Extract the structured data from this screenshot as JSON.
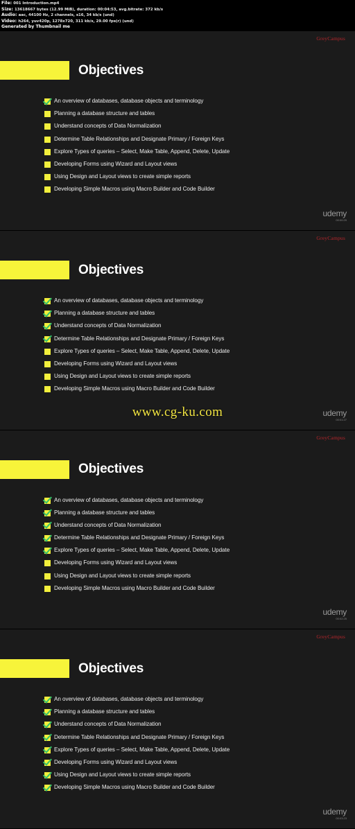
{
  "mediainfo": {
    "lines": [
      {
        "key": "File:",
        "value": "001 Introduction.mp4"
      },
      {
        "key": "Size:",
        "value": "13618667 bytes (12.99 MiB), duration: 00:04:53, avg.bitrate: 372 kb/s"
      },
      {
        "key": "Audio:",
        "value": "aac, 44100 Hz, 2 channels, s16, 34 kb/s (und)"
      },
      {
        "key": "Video:",
        "value": "h264, yuv420p, 1278x720, 311 kb/s, 29.00 fps(r) (und)"
      },
      {
        "key": "Generated by Thumbnail me",
        "value": ""
      }
    ]
  },
  "slide_title": "Objectives",
  "brand": "GreyCampus",
  "watermark": {
    "udemy": "udemy",
    "cgku": "www.cg-ku.com"
  },
  "objectives": [
    "An overview of databases, database objects and terminology",
    "Planning a database structure and tables",
    "Understand concepts of Data Normalization",
    "Determine Table Relationships and Designate Primary / Foreign Keys",
    "Explore Types of queries – Select, Make Table, Append, Delete, Update",
    " Developing Forms using Wizard and Layout views",
    "Using Design and Layout views to create simple reports",
    "Developing Simple Macros using Macro Builder and Code Builder"
  ],
  "slides": [
    {
      "timestamp": "00:00:29",
      "checked_count": 1,
      "show_cgku": false
    },
    {
      "timestamp": "00:01:27",
      "checked_count": 4,
      "show_cgku": true
    },
    {
      "timestamp": "00:02:25",
      "checked_count": 5,
      "show_cgku": false
    },
    {
      "timestamp": "00:03:23",
      "checked_count": 8,
      "show_cgku": false
    }
  ],
  "colors": {
    "slide_bg": "#1b1b1b",
    "accent_yellow": "#f7f43a",
    "check_green": "#36c06a",
    "brand_red": "#c1272d",
    "cgku_yellow": "#f2e542"
  }
}
